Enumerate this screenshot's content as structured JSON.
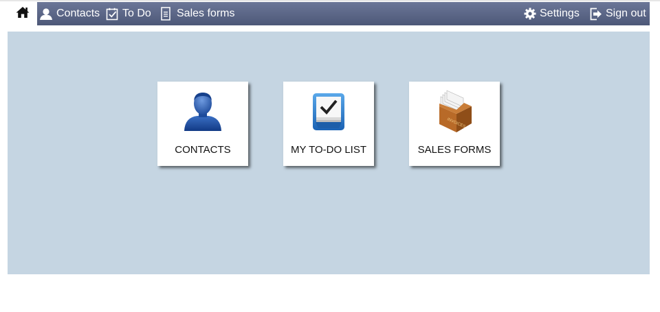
{
  "navbar": {
    "home_icon": "home-icon",
    "contacts_label": "Contacts",
    "todo_label": "To Do",
    "sales_forms_label": "Sales forms",
    "settings_label": "Settings",
    "signout_label": "Sign out"
  },
  "tiles": [
    {
      "label": "CONTACTS",
      "icon": "person-icon"
    },
    {
      "label": "MY TO-DO LIST",
      "icon": "todo-tray-icon"
    },
    {
      "label": "SALES FORMS",
      "icon": "file-box-icon"
    }
  ],
  "sales_box_text": "INVOICES",
  "colors": {
    "navbar": "#5a6585",
    "content_background": "#c5d5e2",
    "tile_background": "#ffffff"
  }
}
